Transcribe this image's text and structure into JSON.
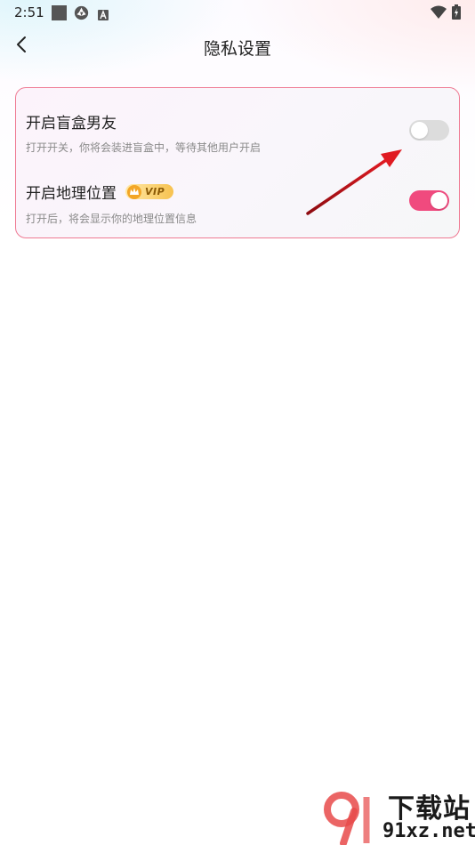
{
  "status_bar": {
    "time": "2:51",
    "icons": [
      "square-icon",
      "aperture-icon",
      "font-a-icon",
      "wifi-icon",
      "battery-icon"
    ]
  },
  "app_bar": {
    "title": "隐私设置",
    "back_icon": "chevron-left-icon"
  },
  "settings": [
    {
      "title": "开启盲盒男友",
      "description": "打开开关，你将会装进盲盒中，等待其他用户开启",
      "enabled": false
    },
    {
      "title": "开启地理位置",
      "badge": "VIP",
      "description": "打开后，将会显示你的地理位置信息",
      "enabled": true
    }
  ],
  "watermark": {
    "line1": "下载站",
    "line2": "91xz.net"
  },
  "colors": {
    "accent": "#f04a7e",
    "card_border": "#ef7a93",
    "toggle_off": "#dcdcdc",
    "annotation_arrow": "#d4151c",
    "watermark_red": "#e84a4a"
  }
}
